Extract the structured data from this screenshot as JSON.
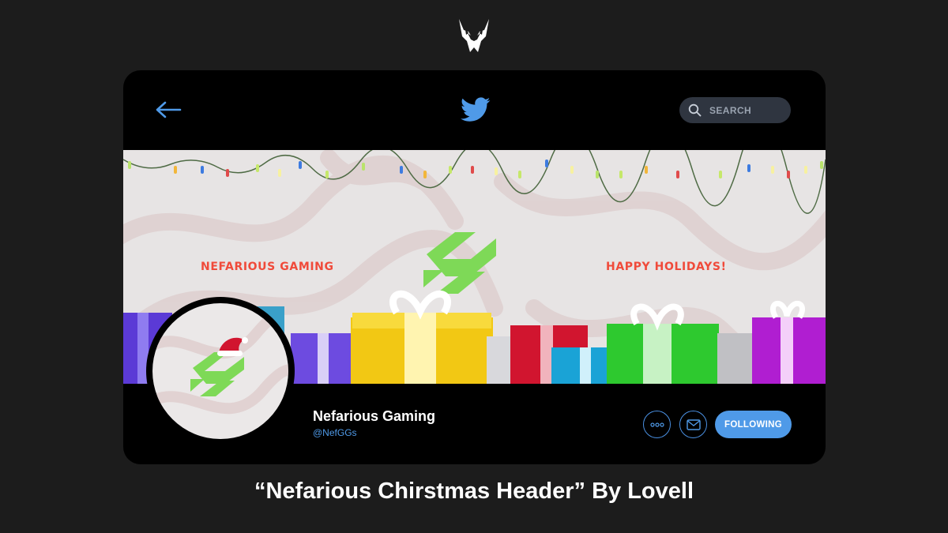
{
  "brand_logo": "nefarious-mask-logo",
  "header": {
    "back_icon": "arrow-left-icon",
    "app_icon": "twitter-bird-icon",
    "search": {
      "placeholder": "SEARCH",
      "icon": "search-icon"
    }
  },
  "banner": {
    "left_text": "NEFARIOUS GAMING",
    "right_text": "HAPPY HOLIDAYS!",
    "decorations": [
      "string-lights",
      "wrapped-gifts",
      "nefarious-n-logo"
    ]
  },
  "profile": {
    "display_name": "Nefarious Gaming",
    "handle": "@NefGGs",
    "avatar": "nefarious-n-logo-with-santa-hat"
  },
  "actions": {
    "more_icon": "more-dots-icon",
    "message_icon": "envelope-icon",
    "follow_label": "FOLLOWING"
  },
  "caption": "“Nefarious Chirstmas Header” By Lovell",
  "colors": {
    "accent_blue": "#4f9ae8",
    "banner_red": "#f04a3a",
    "logo_green": "#7ed957",
    "card_bg": "#000000",
    "page_bg": "#1c1c1c"
  }
}
